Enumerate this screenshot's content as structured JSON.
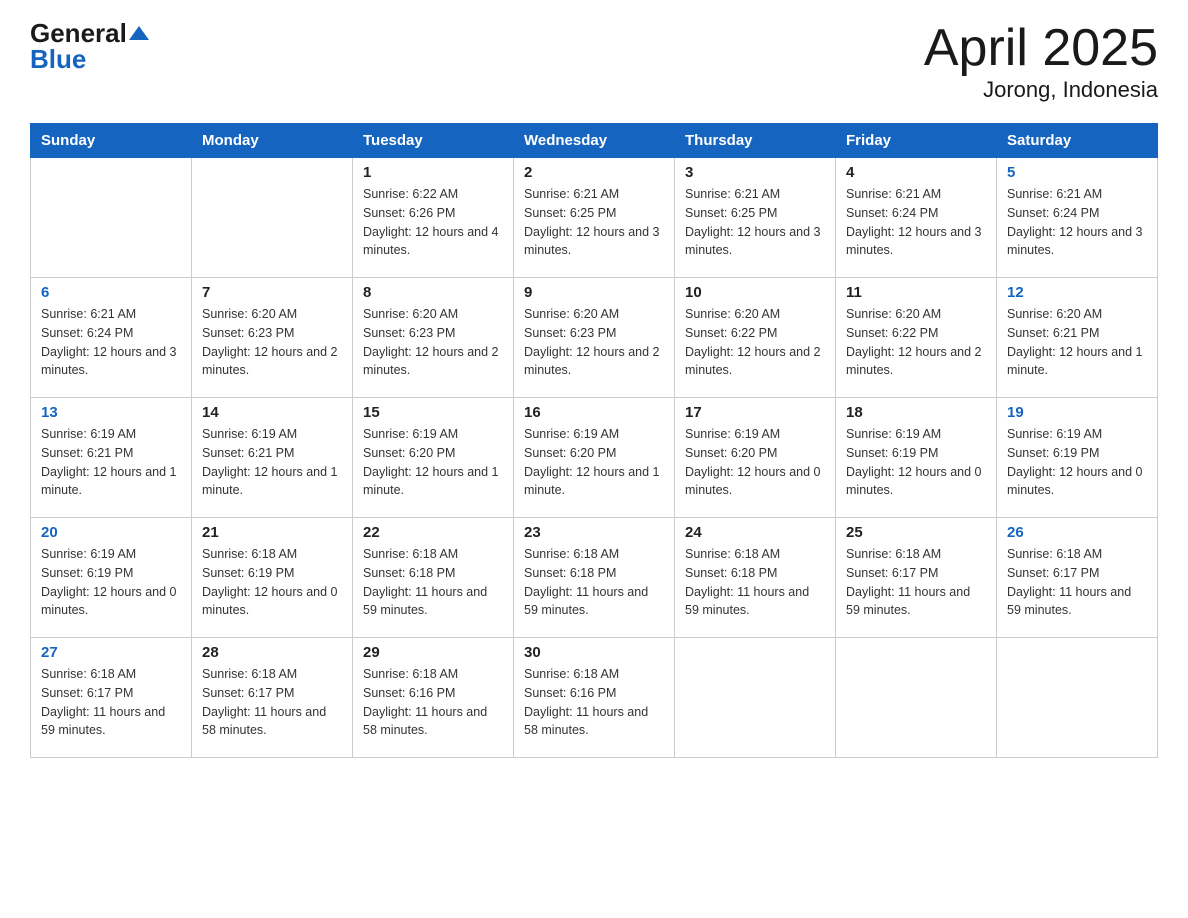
{
  "header": {
    "logo_general": "General",
    "logo_blue": "Blue",
    "title": "April 2025",
    "subtitle": "Jorong, Indonesia"
  },
  "days_of_week": [
    "Sunday",
    "Monday",
    "Tuesday",
    "Wednesday",
    "Thursday",
    "Friday",
    "Saturday"
  ],
  "weeks": [
    [
      {
        "day": "",
        "sunrise": "",
        "sunset": "",
        "daylight": ""
      },
      {
        "day": "",
        "sunrise": "",
        "sunset": "",
        "daylight": ""
      },
      {
        "day": "1",
        "sunrise": "Sunrise: 6:22 AM",
        "sunset": "Sunset: 6:26 PM",
        "daylight": "Daylight: 12 hours and 4 minutes."
      },
      {
        "day": "2",
        "sunrise": "Sunrise: 6:21 AM",
        "sunset": "Sunset: 6:25 PM",
        "daylight": "Daylight: 12 hours and 3 minutes."
      },
      {
        "day": "3",
        "sunrise": "Sunrise: 6:21 AM",
        "sunset": "Sunset: 6:25 PM",
        "daylight": "Daylight: 12 hours and 3 minutes."
      },
      {
        "day": "4",
        "sunrise": "Sunrise: 6:21 AM",
        "sunset": "Sunset: 6:24 PM",
        "daylight": "Daylight: 12 hours and 3 minutes."
      },
      {
        "day": "5",
        "sunrise": "Sunrise: 6:21 AM",
        "sunset": "Sunset: 6:24 PM",
        "daylight": "Daylight: 12 hours and 3 minutes."
      }
    ],
    [
      {
        "day": "6",
        "sunrise": "Sunrise: 6:21 AM",
        "sunset": "Sunset: 6:24 PM",
        "daylight": "Daylight: 12 hours and 3 minutes."
      },
      {
        "day": "7",
        "sunrise": "Sunrise: 6:20 AM",
        "sunset": "Sunset: 6:23 PM",
        "daylight": "Daylight: 12 hours and 2 minutes."
      },
      {
        "day": "8",
        "sunrise": "Sunrise: 6:20 AM",
        "sunset": "Sunset: 6:23 PM",
        "daylight": "Daylight: 12 hours and 2 minutes."
      },
      {
        "day": "9",
        "sunrise": "Sunrise: 6:20 AM",
        "sunset": "Sunset: 6:23 PM",
        "daylight": "Daylight: 12 hours and 2 minutes."
      },
      {
        "day": "10",
        "sunrise": "Sunrise: 6:20 AM",
        "sunset": "Sunset: 6:22 PM",
        "daylight": "Daylight: 12 hours and 2 minutes."
      },
      {
        "day": "11",
        "sunrise": "Sunrise: 6:20 AM",
        "sunset": "Sunset: 6:22 PM",
        "daylight": "Daylight: 12 hours and 2 minutes."
      },
      {
        "day": "12",
        "sunrise": "Sunrise: 6:20 AM",
        "sunset": "Sunset: 6:21 PM",
        "daylight": "Daylight: 12 hours and 1 minute."
      }
    ],
    [
      {
        "day": "13",
        "sunrise": "Sunrise: 6:19 AM",
        "sunset": "Sunset: 6:21 PM",
        "daylight": "Daylight: 12 hours and 1 minute."
      },
      {
        "day": "14",
        "sunrise": "Sunrise: 6:19 AM",
        "sunset": "Sunset: 6:21 PM",
        "daylight": "Daylight: 12 hours and 1 minute."
      },
      {
        "day": "15",
        "sunrise": "Sunrise: 6:19 AM",
        "sunset": "Sunset: 6:20 PM",
        "daylight": "Daylight: 12 hours and 1 minute."
      },
      {
        "day": "16",
        "sunrise": "Sunrise: 6:19 AM",
        "sunset": "Sunset: 6:20 PM",
        "daylight": "Daylight: 12 hours and 1 minute."
      },
      {
        "day": "17",
        "sunrise": "Sunrise: 6:19 AM",
        "sunset": "Sunset: 6:20 PM",
        "daylight": "Daylight: 12 hours and 0 minutes."
      },
      {
        "day": "18",
        "sunrise": "Sunrise: 6:19 AM",
        "sunset": "Sunset: 6:19 PM",
        "daylight": "Daylight: 12 hours and 0 minutes."
      },
      {
        "day": "19",
        "sunrise": "Sunrise: 6:19 AM",
        "sunset": "Sunset: 6:19 PM",
        "daylight": "Daylight: 12 hours and 0 minutes."
      }
    ],
    [
      {
        "day": "20",
        "sunrise": "Sunrise: 6:19 AM",
        "sunset": "Sunset: 6:19 PM",
        "daylight": "Daylight: 12 hours and 0 minutes."
      },
      {
        "day": "21",
        "sunrise": "Sunrise: 6:18 AM",
        "sunset": "Sunset: 6:19 PM",
        "daylight": "Daylight: 12 hours and 0 minutes."
      },
      {
        "day": "22",
        "sunrise": "Sunrise: 6:18 AM",
        "sunset": "Sunset: 6:18 PM",
        "daylight": "Daylight: 11 hours and 59 minutes."
      },
      {
        "day": "23",
        "sunrise": "Sunrise: 6:18 AM",
        "sunset": "Sunset: 6:18 PM",
        "daylight": "Daylight: 11 hours and 59 minutes."
      },
      {
        "day": "24",
        "sunrise": "Sunrise: 6:18 AM",
        "sunset": "Sunset: 6:18 PM",
        "daylight": "Daylight: 11 hours and 59 minutes."
      },
      {
        "day": "25",
        "sunrise": "Sunrise: 6:18 AM",
        "sunset": "Sunset: 6:17 PM",
        "daylight": "Daylight: 11 hours and 59 minutes."
      },
      {
        "day": "26",
        "sunrise": "Sunrise: 6:18 AM",
        "sunset": "Sunset: 6:17 PM",
        "daylight": "Daylight: 11 hours and 59 minutes."
      }
    ],
    [
      {
        "day": "27",
        "sunrise": "Sunrise: 6:18 AM",
        "sunset": "Sunset: 6:17 PM",
        "daylight": "Daylight: 11 hours and 59 minutes."
      },
      {
        "day": "28",
        "sunrise": "Sunrise: 6:18 AM",
        "sunset": "Sunset: 6:17 PM",
        "daylight": "Daylight: 11 hours and 58 minutes."
      },
      {
        "day": "29",
        "sunrise": "Sunrise: 6:18 AM",
        "sunset": "Sunset: 6:16 PM",
        "daylight": "Daylight: 11 hours and 58 minutes."
      },
      {
        "day": "30",
        "sunrise": "Sunrise: 6:18 AM",
        "sunset": "Sunset: 6:16 PM",
        "daylight": "Daylight: 11 hours and 58 minutes."
      },
      {
        "day": "",
        "sunrise": "",
        "sunset": "",
        "daylight": ""
      },
      {
        "day": "",
        "sunrise": "",
        "sunset": "",
        "daylight": ""
      },
      {
        "day": "",
        "sunrise": "",
        "sunset": "",
        "daylight": ""
      }
    ]
  ]
}
